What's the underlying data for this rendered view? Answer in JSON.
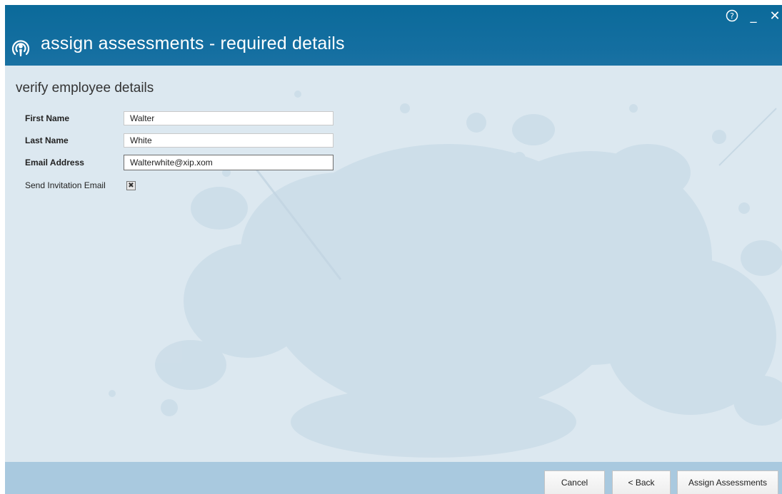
{
  "window": {
    "title": "assign assessments - required details",
    "controls": {
      "help": "?",
      "minimize": "_",
      "close": "✕"
    },
    "accent_color": "#0f6c9d"
  },
  "form": {
    "section_title": "verify employee details",
    "fields": {
      "first_name": {
        "label": "First Name",
        "value": "Walter"
      },
      "last_name": {
        "label": "Last Name",
        "value": "White"
      },
      "email": {
        "label": "Email Address",
        "value": "Walterwhite@xip.xom"
      }
    },
    "send_invitation": {
      "label": "Send Invitation Email",
      "checked": true,
      "mark": "✖"
    }
  },
  "footer": {
    "cancel_label": "Cancel",
    "back_label": "< Back",
    "assign_label": "Assign Assessments"
  }
}
